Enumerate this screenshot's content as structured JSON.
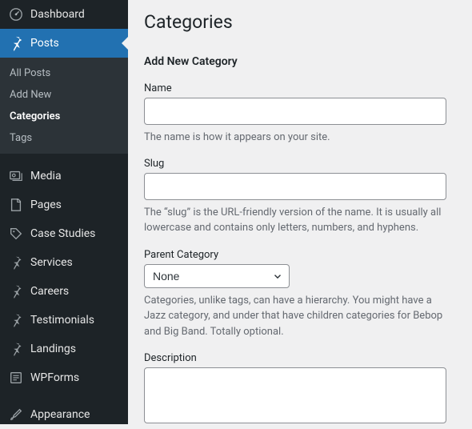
{
  "sidebar": {
    "items": [
      {
        "label": "Dashboard"
      },
      {
        "label": "Posts"
      },
      {
        "label": "Media"
      },
      {
        "label": "Pages"
      },
      {
        "label": "Case Studies"
      },
      {
        "label": "Services"
      },
      {
        "label": "Careers"
      },
      {
        "label": "Testimonials"
      },
      {
        "label": "Landings"
      },
      {
        "label": "WPForms"
      },
      {
        "label": "Appearance"
      }
    ],
    "posts_submenu": [
      {
        "label": "All Posts"
      },
      {
        "label": "Add New"
      },
      {
        "label": "Categories"
      },
      {
        "label": "Tags"
      }
    ]
  },
  "page": {
    "title": "Categories",
    "subtitle": "Add New Category"
  },
  "form": {
    "name": {
      "label": "Name",
      "value": "",
      "desc": "The name is how it appears on your site."
    },
    "slug": {
      "label": "Slug",
      "value": "",
      "desc": "The “slug” is the URL-friendly version of the name. It is usually all lowercase and contains only letters, numbers, and hyphens."
    },
    "parent": {
      "label": "Parent Category",
      "selected": "None",
      "desc": "Categories, unlike tags, can have a hierarchy. You might have a Jazz category, and under that have children categories for Bebop and Big Band. Totally optional."
    },
    "description": {
      "label": "Description",
      "value": ""
    }
  }
}
